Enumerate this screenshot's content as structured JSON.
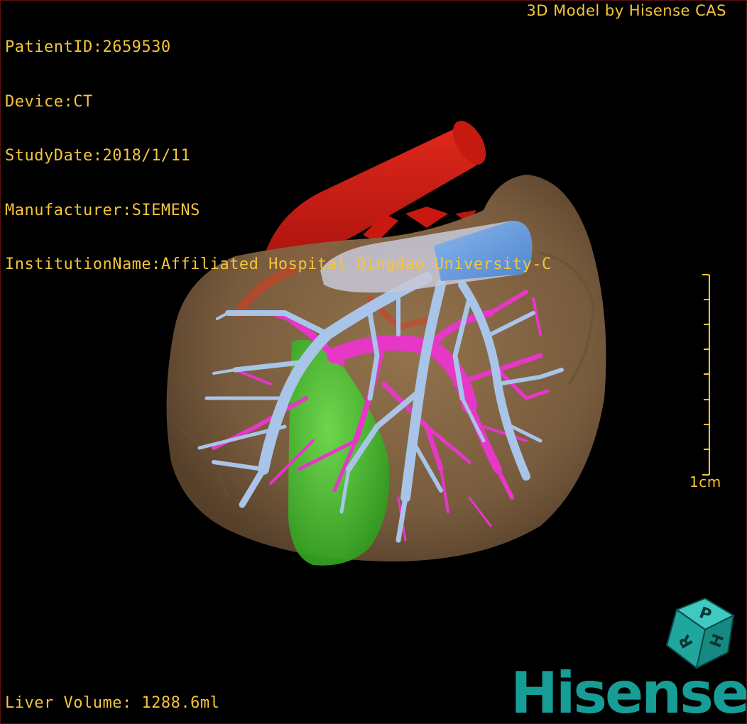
{
  "info": {
    "patient_id": "PatientID:2659530",
    "device": "Device:CT",
    "study_date": "StudyDate:2018/1/11",
    "manufacturer": "Manufacturer:SIEMENS",
    "institution": "InstitutionName:Affiliated Hospital Qingdao University-C"
  },
  "brand_credit": "3D Model by Hisense CAS",
  "liver_volume": "Liver Volume: 1288.6ml",
  "scale": {
    "label": "1cm"
  },
  "logo": {
    "text": "Hisense"
  },
  "orientation_cube": {
    "faces": [
      "H",
      "P",
      "R"
    ]
  },
  "colors": {
    "overlay_text": "#f5c53a",
    "liver": "#8b6a47",
    "portal_vein": "#e637c7",
    "hepatic_vein": "#a8c4e8",
    "ivc": "#6fa3e3",
    "artery": "#d21c12",
    "gallbladder": "#3ec72a",
    "logo": "#159d96"
  }
}
